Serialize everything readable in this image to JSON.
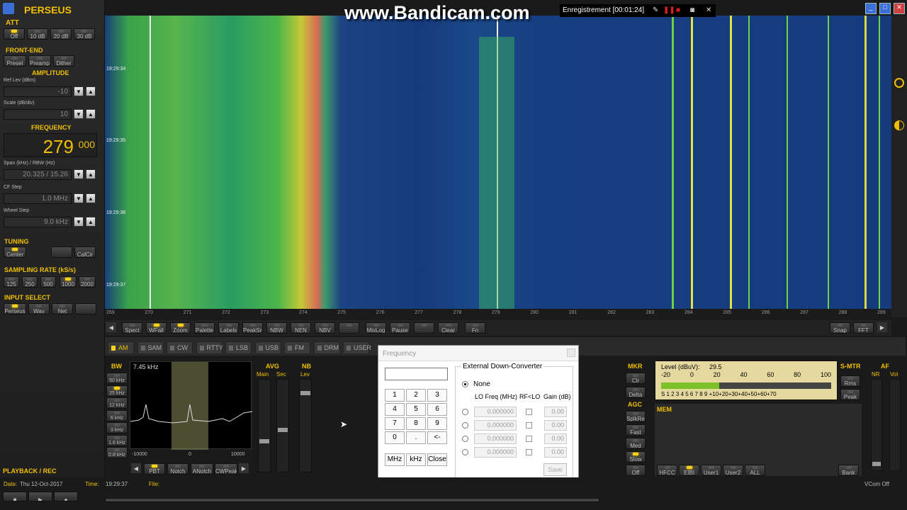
{
  "app": {
    "title": "PERSEUS"
  },
  "att": {
    "label": "ATT",
    "buttons": [
      "Off",
      "10 dB",
      "20 dB",
      "30 dB"
    ]
  },
  "frontend": {
    "label": "FRONT-END",
    "buttons": [
      "Presel",
      "Preamp",
      "Dither"
    ]
  },
  "amplitude": {
    "label": "AMPLITUDE",
    "ref_label": "Ref Lev (dBm)",
    "ref_value": "-10",
    "scale_label": "Scale (dB/div)",
    "scale_value": "10"
  },
  "frequency": {
    "label": "FREQUENCY",
    "main": "279",
    "sub": "000",
    "span_label": "Span (kHz) / RBW (Hz)",
    "span_value": "20.325 / 15.26",
    "cf_label": "CF Step",
    "cf_value": "1.0 MHz",
    "wheel_label": "Wheel Step",
    "wheel_value": "9.0 kHz"
  },
  "tuning": {
    "label": "TUNING",
    "center": "Center",
    "calcir": "CalCir"
  },
  "sampling": {
    "label": "SAMPLING RATE (kS/s)",
    "rates": [
      "125",
      "250",
      "500",
      "1000",
      "2000"
    ]
  },
  "input": {
    "label": "INPUT SELECT",
    "buttons": [
      "Perseus",
      "Wav",
      "Net"
    ]
  },
  "playback": {
    "label": "PLAYBACK / REC",
    "date_label": "Date:",
    "date": "Thu 12-Oct-2017",
    "time_label": "Time:",
    "time": "19:29:37",
    "file_label": "File:"
  },
  "watermark": "www.Bandicam.com",
  "recorder": {
    "status": "Enregistrement [00:01:24]"
  },
  "waterfall": {
    "timestamps": [
      "19:29:34",
      "19:29:35",
      "19:29:36",
      "19:29:37"
    ],
    "ticks": [
      "269",
      "270",
      "271",
      "272",
      "273",
      "274",
      "275",
      "276",
      "277",
      "278",
      "279",
      "280",
      "281",
      "282",
      "283",
      "284",
      "285",
      "286",
      "287",
      "288",
      "289"
    ]
  },
  "toolbar": [
    "Spect",
    "WFall",
    "Zoom",
    "Palette",
    "Labels",
    "PeakSrc",
    "NBW",
    "NEN",
    "NBV",
    "",
    "MixLog",
    "Pause",
    "",
    "Clear",
    "Fn"
  ],
  "toolbar_right": [
    "Snap",
    "FFT"
  ],
  "modes": [
    {
      "label": "AM",
      "active": true
    },
    {
      "label": "SAM"
    },
    {
      "label": "CW"
    },
    {
      "label": "RTTY"
    },
    {
      "label": "LSB"
    },
    {
      "label": "USB"
    },
    {
      "label": "FM"
    },
    {
      "label": "DRM"
    },
    {
      "label": "USER"
    }
  ],
  "bw": {
    "label": "BW",
    "value": "7.45 kHz",
    "steps": [
      "50 kHz",
      "25 kHz",
      "12 kHz",
      "6 kHz",
      "3 kHz",
      "1.6 kHz",
      "0.8 kHz"
    ],
    "axis": [
      "-10000",
      "0",
      "10000"
    ],
    "buttons": [
      "PBT",
      "Notch",
      "ANotch",
      "CWPeak"
    ]
  },
  "avg": {
    "label": "AVG",
    "main": "Main",
    "sec": "Sec"
  },
  "nb": {
    "label": "NB",
    "lev": "Lev"
  },
  "dialog": {
    "title": "Frequency",
    "keys": [
      "1",
      "2",
      "3",
      "4",
      "5",
      "6",
      "7",
      "8",
      "9",
      "0",
      ".",
      "<-"
    ],
    "units": [
      "MHz",
      "kHz",
      "Close"
    ],
    "edc_title": "External Down-Converter",
    "none_label": "None",
    "col_lo": "LO Freq (MHz)",
    "col_rf": "RF<LO",
    "col_gain": "Gain (dB)",
    "rows": [
      {
        "lo": "0.000000",
        "gain": "0.00"
      },
      {
        "lo": "0.000000",
        "gain": "0.00"
      },
      {
        "lo": "0.000000",
        "gain": "0.00"
      },
      {
        "lo": "0.000000",
        "gain": "0.00"
      }
    ],
    "save": "Save"
  },
  "mkr": {
    "label": "MKR",
    "buttons": [
      "Clr",
      "Delta"
    ]
  },
  "agc": {
    "label": "AGC",
    "buttons": [
      "SplkRej",
      "Fast",
      "Med",
      "Slow",
      "Off"
    ]
  },
  "level": {
    "label": "Level (dBuV):",
    "value": "29.5",
    "scale_top": [
      "-20",
      "0",
      "20",
      "40",
      "60",
      "80",
      "100"
    ],
    "scale_bottom": "S 1 2 3 4 5 6 7 8 9 +10+20+30+40+50+60+70",
    "fraction": 0.34
  },
  "smtr": {
    "label": "S-MTR",
    "buttons": [
      "Rms",
      "Peak"
    ]
  },
  "af": {
    "label": "AF",
    "nr": "NR",
    "vol": "Vol"
  },
  "mem": {
    "label": "MEM",
    "buttons": [
      "HFCC",
      "EIBI",
      "User1",
      "User2",
      "ALL",
      "Bank"
    ]
  },
  "vcom": "VCom Off"
}
